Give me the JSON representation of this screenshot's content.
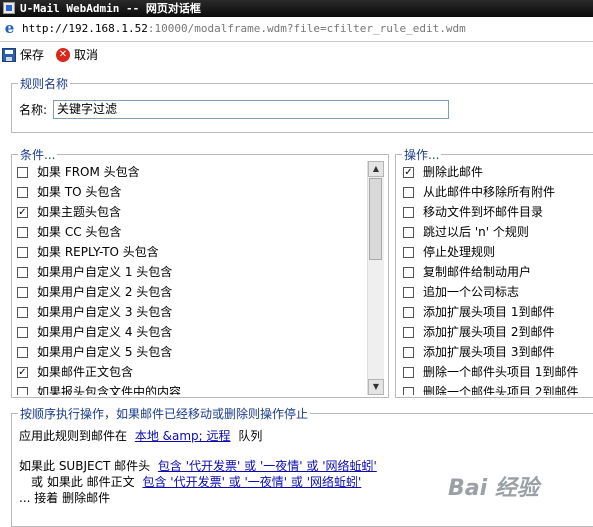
{
  "window": {
    "title": "U-Mail WebAdmin -- 网页对话框"
  },
  "address": {
    "host": "http://192.168.1.52",
    "rest": ":10000/modalframe.wdm?file=cfilter_rule_edit.wdm"
  },
  "toolbar": {
    "save_label": "保存",
    "cancel_label": "取消"
  },
  "rule_name": {
    "legend": "规则名称",
    "label": "名称:",
    "value": "关键字过滤"
  },
  "conditions": {
    "legend": "条件...",
    "items": [
      {
        "label": "如果 FROM 头包含",
        "checked": false
      },
      {
        "label": "如果 TO 头包含",
        "checked": false
      },
      {
        "label": "如果主题头包含",
        "checked": true
      },
      {
        "label": "如果 CC 头包含",
        "checked": false
      },
      {
        "label": "如果 REPLY-TO 头包含",
        "checked": false
      },
      {
        "label": "如果用户自定义 1 头包含",
        "checked": false
      },
      {
        "label": "如果用户自定义 2 头包含",
        "checked": false
      },
      {
        "label": "如果用户自定义 3 头包含",
        "checked": false
      },
      {
        "label": "如果用户自定义 4 头包含",
        "checked": false
      },
      {
        "label": "如果用户自定义 5 头包含",
        "checked": false
      },
      {
        "label": "如果邮件正文包含",
        "checked": true
      },
      {
        "label": "如果报头包含文件中的内容",
        "checked": false
      }
    ]
  },
  "actions": {
    "legend": "操作...",
    "items": [
      {
        "label": "删除此邮件",
        "checked": true
      },
      {
        "label": "从此邮件中移除所有附件",
        "checked": false
      },
      {
        "label": "移动文件到坏邮件目录",
        "checked": false
      },
      {
        "label": "跳过以后 'n' 个规则",
        "checked": false
      },
      {
        "label": "停止处理规则",
        "checked": false
      },
      {
        "label": "复制邮件给制动用户",
        "checked": false
      },
      {
        "label": "追加一个公司标志",
        "checked": false
      },
      {
        "label": "添加扩展头项目 1到邮件",
        "checked": false
      },
      {
        "label": "添加扩展头项目 2到邮件",
        "checked": false
      },
      {
        "label": "添加扩展头项目 3到邮件",
        "checked": false
      },
      {
        "label": "删除一个邮件头项目 1到邮件",
        "checked": false
      },
      {
        "label": "删除一个邮件头项目 2到邮件",
        "checked": false
      }
    ]
  },
  "summary": {
    "legend": "按顺序执行操作，如果邮件已经移动或删除则操作停止",
    "apply_prefix": "应用此规则到邮件在",
    "apply_link": "本地 &amp; 远程",
    "apply_suffix": "队列",
    "line2_prefix": "如果此 SUBJECT 邮件头",
    "line2_link": "包含 '代开发票' 或 '一夜情' 或 '网络蚯蚓'",
    "line3_prefix": "或 如果此 邮件正文",
    "line3_link": "包含 '代开发票' 或 '一夜情' 或 '网络蚯蚓'",
    "line4": "... 接着 删除邮件"
  },
  "icons": {
    "address": "ie-icon",
    "save": "save-icon",
    "cancel": "cancel-icon"
  },
  "watermark": "Bai 经验"
}
